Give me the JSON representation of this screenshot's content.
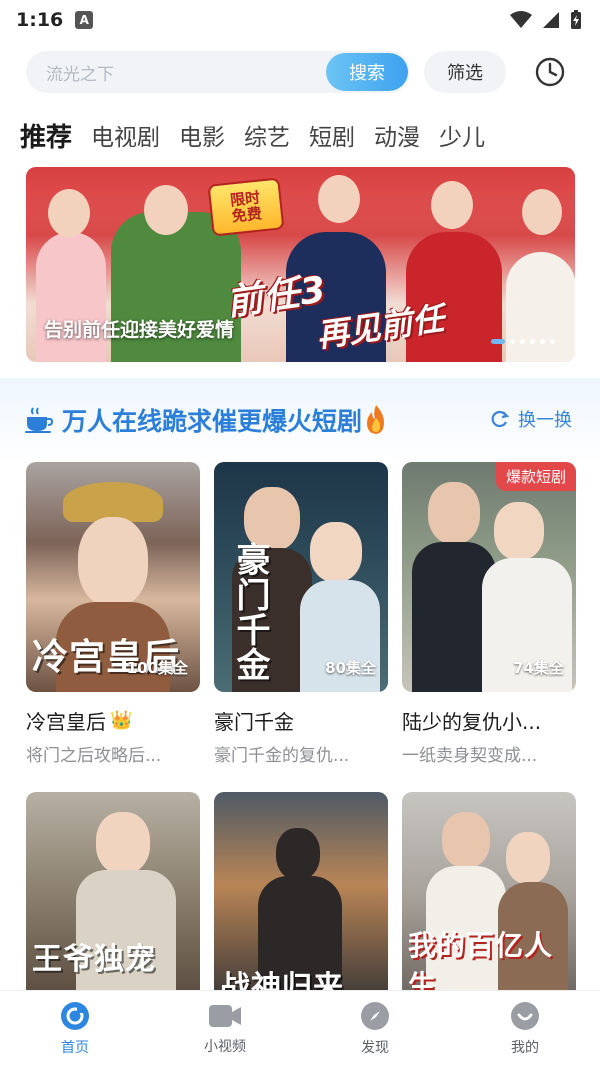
{
  "status_bar": {
    "time": "1:16",
    "notification_badge": "A"
  },
  "search": {
    "placeholder": "流光之下",
    "button_label": "搜索",
    "filter_label": "筛选"
  },
  "tabs": [
    {
      "label": "推荐",
      "active": true
    },
    {
      "label": "电视剧"
    },
    {
      "label": "电影"
    },
    {
      "label": "综艺"
    },
    {
      "label": "短剧"
    },
    {
      "label": "动漫"
    },
    {
      "label": "少儿"
    }
  ],
  "banner": {
    "caption": "告别前任迎接美好爱情",
    "promo_tag_line1": "限时",
    "promo_tag_line2": "免费",
    "art_title_line1": "前任3",
    "art_title_line2": "再见前任",
    "page_count": 6,
    "active_index": 0
  },
  "section": {
    "title": "万人在线跪求催更爆火短剧",
    "refresh_label": "换一换"
  },
  "cards": [
    {
      "name": "冷宫皇后",
      "desc": "将门之后攻略后...",
      "episodes": "100集全",
      "poster_text": "冷宫皇后",
      "crown": "👑"
    },
    {
      "name": "豪门千金",
      "desc": "豪门千金的复仇...",
      "episodes": "80集全",
      "poster_text": "豪门千金"
    },
    {
      "name": "陆少的复仇小...",
      "desc": "一纸卖身契变成...",
      "episodes": "74集全",
      "badge": "爆款短剧"
    },
    {
      "poster_text": "王爷独宠"
    },
    {
      "poster_text": "战神归来"
    },
    {
      "poster_text": "我的百亿人生"
    }
  ],
  "bottom_nav": [
    {
      "label": "首页",
      "icon": "home-icon",
      "active": true
    },
    {
      "label": "小视频",
      "icon": "video-icon"
    },
    {
      "label": "发现",
      "icon": "compass-icon"
    },
    {
      "label": "我的",
      "icon": "profile-icon"
    }
  ],
  "colors": {
    "accent": "#2d86e0",
    "section_title": "#2c7fd8",
    "badge_red": "#e2474a"
  }
}
